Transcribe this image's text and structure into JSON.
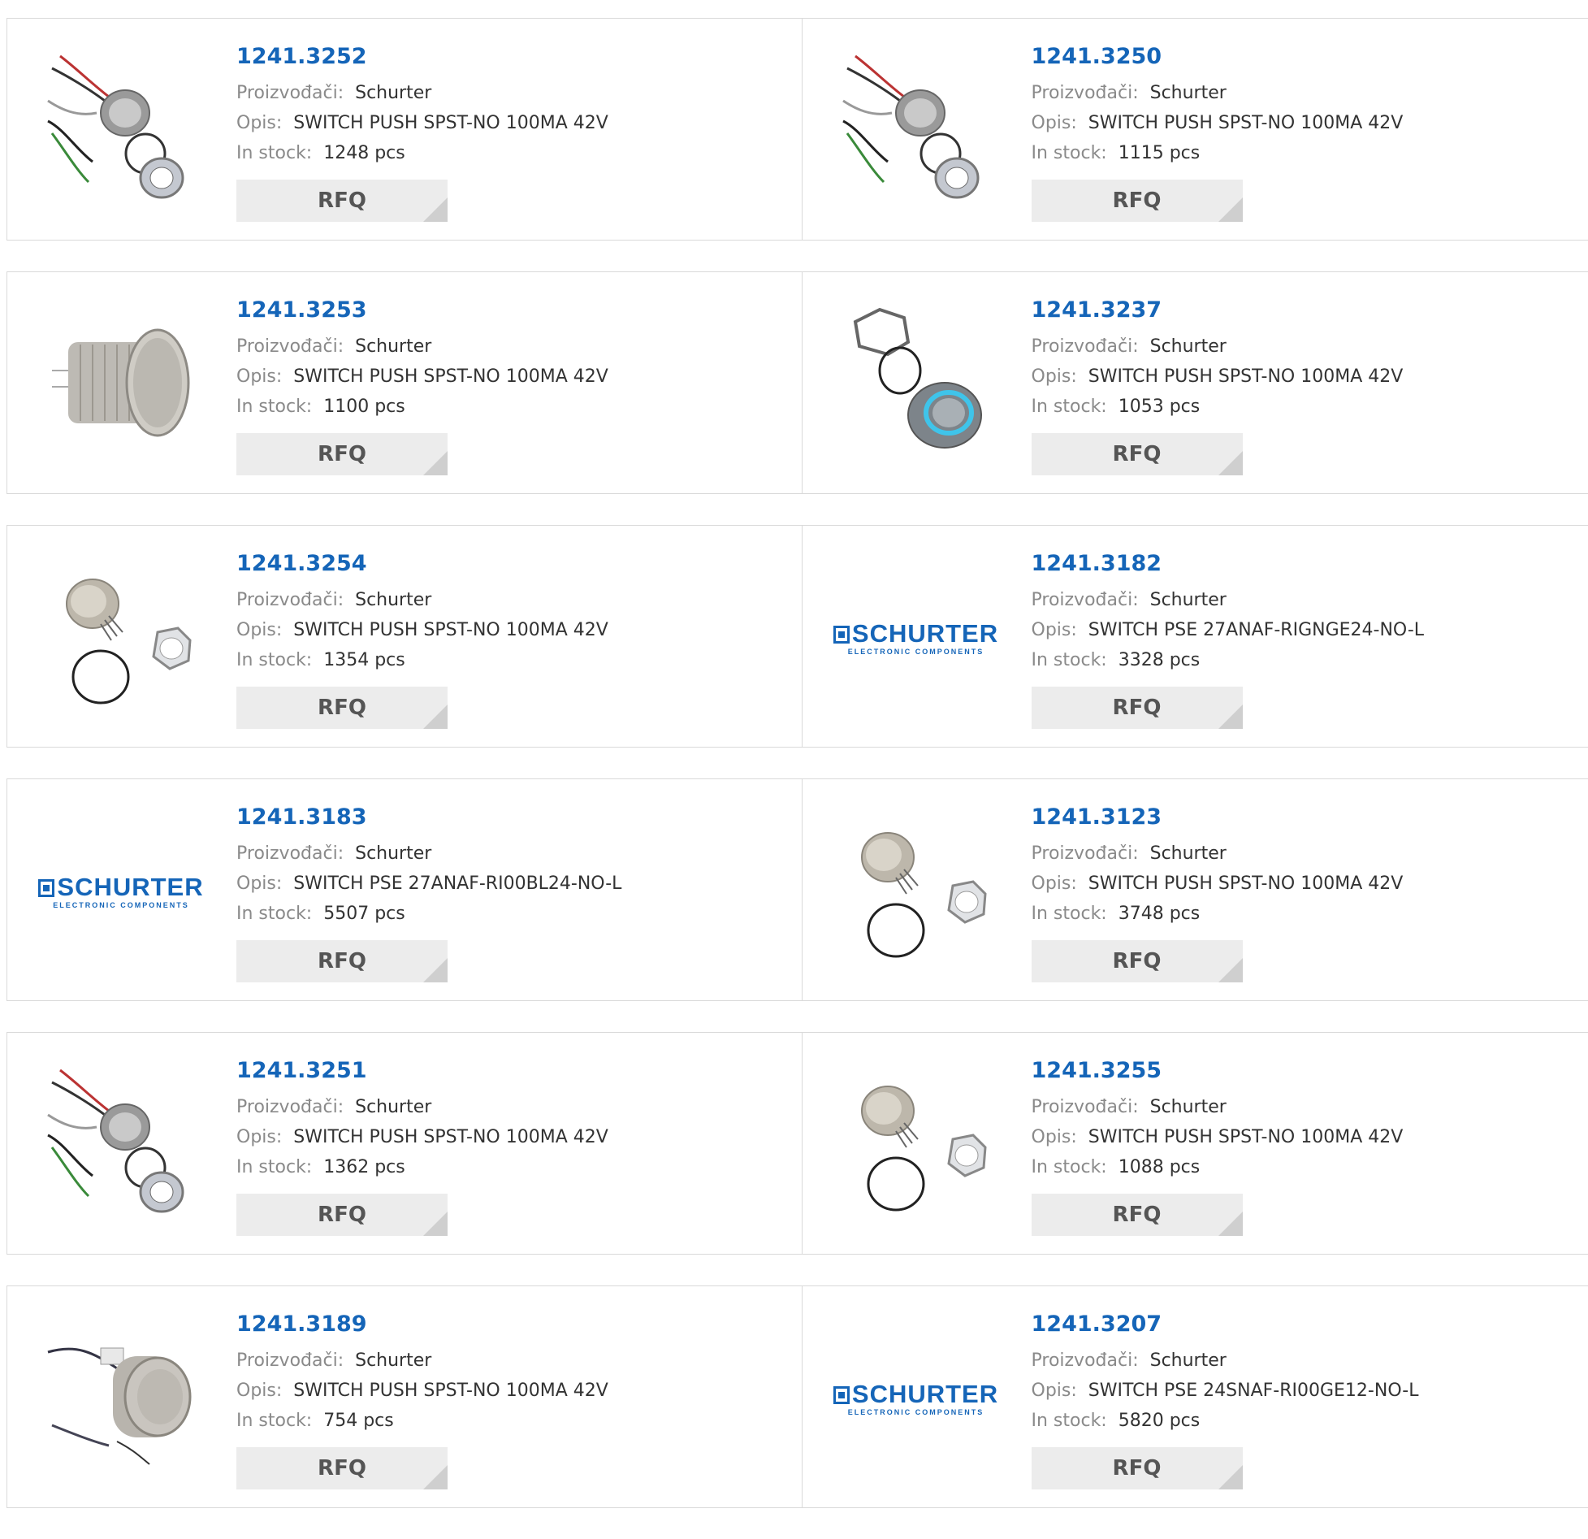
{
  "labels": {
    "manufacturer": "Proizvođači:",
    "description": "Opis:",
    "stock": "In stock:",
    "rfq": "RFQ"
  },
  "brand_logo": {
    "name": "SCHURTER",
    "tagline": "ELECTRONIC COMPONENTS"
  },
  "colors": {
    "link": "#1565b8",
    "label": "#8a8a8a",
    "border": "#d9d9d9",
    "button_bg": "#ececec"
  },
  "products": [
    {
      "part": "1241.3252",
      "manufacturer": "Schurter",
      "description": "SWITCH PUSH SPST-NO 100MA 42V",
      "stock": "1248 pcs",
      "image": "wired-switch-icon"
    },
    {
      "part": "1241.3250",
      "manufacturer": "Schurter",
      "description": "SWITCH PUSH SPST-NO 100MA 42V",
      "stock": "1115 pcs",
      "image": "wired-switch-icon"
    },
    {
      "part": "1241.3253",
      "manufacturer": "Schurter",
      "description": "SWITCH PUSH SPST-NO 100MA 42V",
      "stock": "1100 pcs",
      "image": "metal-switch-side-icon"
    },
    {
      "part": "1241.3237",
      "manufacturer": "Schurter",
      "description": "SWITCH PUSH SPST-NO 100MA 42V",
      "stock": "1053 pcs",
      "image": "lit-ring-switch-icon"
    },
    {
      "part": "1241.3254",
      "manufacturer": "Schurter",
      "description": "SWITCH PUSH SPST-NO 100MA 42V",
      "stock": "1354 pcs",
      "image": "pin-switch-kit-icon"
    },
    {
      "part": "1241.3182",
      "manufacturer": "Schurter",
      "description": "SWITCH PSE 27ANAF-RIGNGE24-NO-L",
      "stock": "3328 pcs",
      "image": "logo"
    },
    {
      "part": "1241.3183",
      "manufacturer": "Schurter",
      "description": "SWITCH PSE 27ANAF-RI00BL24-NO-L",
      "stock": "5507 pcs",
      "image": "logo"
    },
    {
      "part": "1241.3123",
      "manufacturer": "Schurter",
      "description": "SWITCH PUSH SPST-NO 100MA 42V",
      "stock": "3748 pcs",
      "image": "pin-switch-kit-icon"
    },
    {
      "part": "1241.3251",
      "manufacturer": "Schurter",
      "description": "SWITCH PUSH SPST-NO 100MA 42V",
      "stock": "1362 pcs",
      "image": "wired-switch-icon"
    },
    {
      "part": "1241.3255",
      "manufacturer": "Schurter",
      "description": "SWITCH PUSH SPST-NO 100MA 42V",
      "stock": "1088 pcs",
      "image": "pin-switch-kit-icon"
    },
    {
      "part": "1241.3189",
      "manufacturer": "Schurter",
      "description": "SWITCH PUSH SPST-NO 100MA 42V",
      "stock": "754 pcs",
      "image": "cable-switch-icon"
    },
    {
      "part": "1241.3207",
      "manufacturer": "Schurter",
      "description": "SWITCH PSE 24SNAF-RI00GE12-NO-L",
      "stock": "5820 pcs",
      "image": "logo"
    }
  ]
}
